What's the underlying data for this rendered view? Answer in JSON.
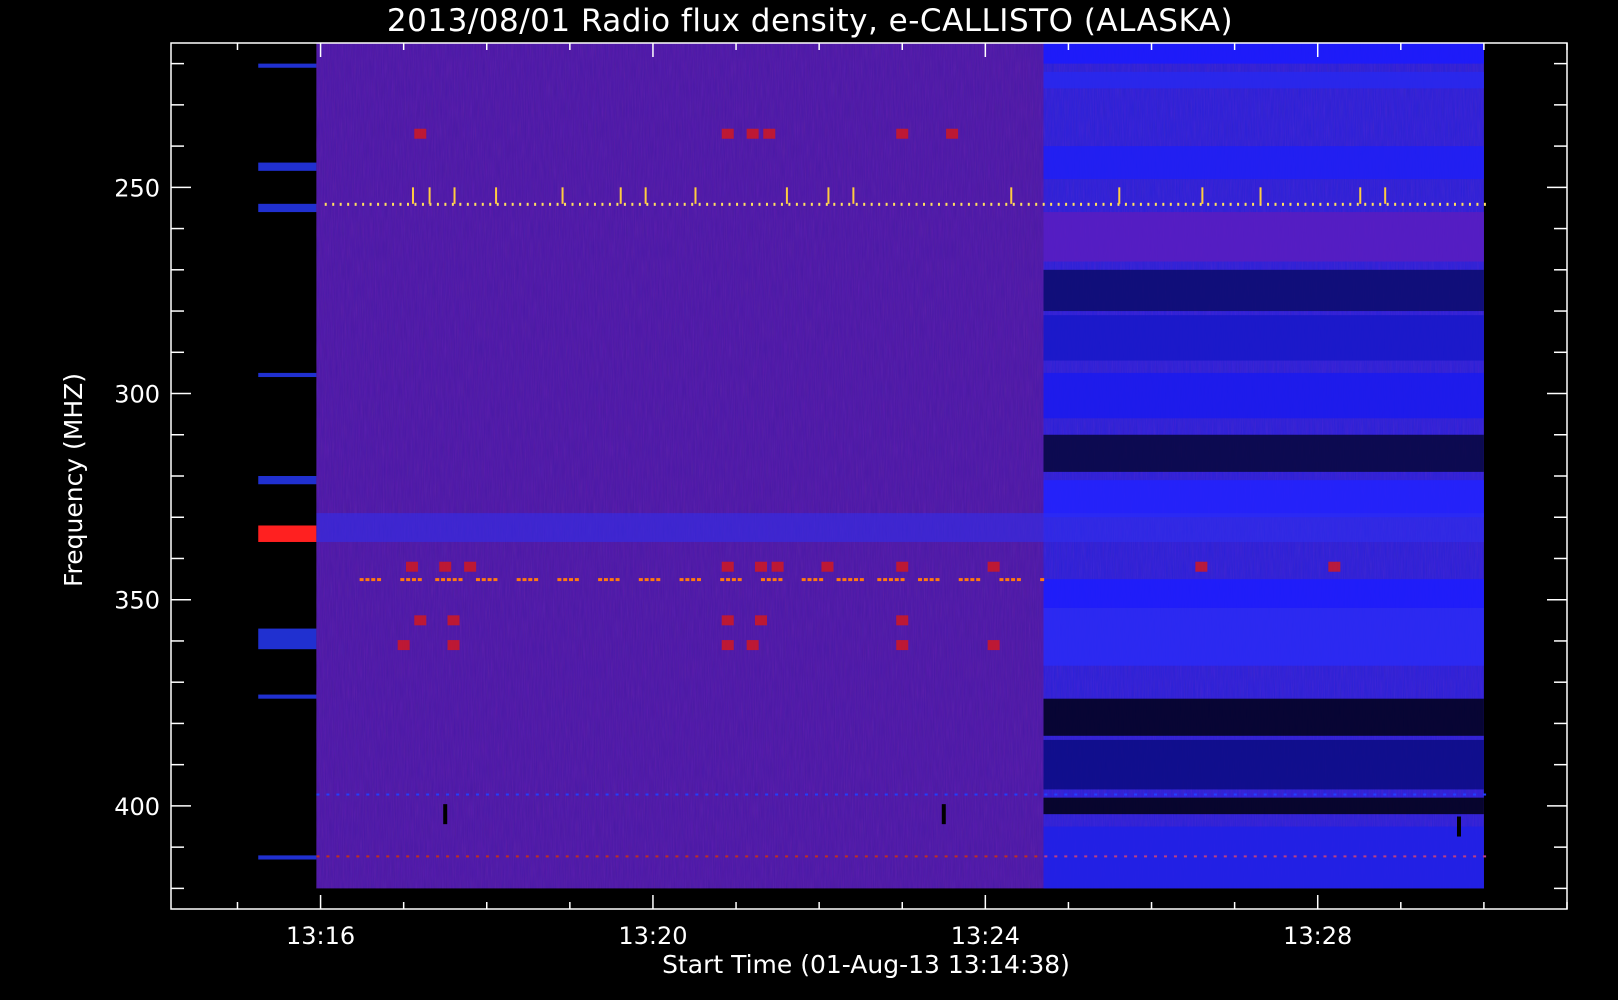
{
  "chart_data": {
    "type": "heatmap",
    "title": "2013/08/01  Radio flux density, e-CALLISTO (ALASKA)",
    "xlabel": "Start Time (01-Aug-13 13:14:38)",
    "ylabel": "Frequency (MHZ)",
    "x_ticks": [
      "13:16",
      "13:20",
      "13:24",
      "13:28"
    ],
    "x_tick_minutes": [
      16,
      20,
      24,
      28
    ],
    "xlim_minutes": [
      14.2,
      31
    ],
    "x_minor_step_minutes": 1,
    "y_ticks": [
      250,
      300,
      350,
      400
    ],
    "ylim": [
      215,
      425
    ],
    "y_minor_step": 10,
    "y_inverted": true,
    "data_start_minute": 15.25,
    "data_gap_end_minute": 15.95,
    "data_end_minute": 30,
    "data_freq_range": [
      215,
      420
    ],
    "segments": [
      {
        "start_minute": 15.95,
        "end_minute": 24.7,
        "base_color": "#4a18a6"
      },
      {
        "start_minute": 24.7,
        "end_minute": 30,
        "base_color": "#2a20d8"
      }
    ],
    "blue_bands_mhz": [
      {
        "from": 215,
        "to": 220,
        "color": "#1a1aff"
      },
      {
        "from": 222,
        "to": 226,
        "color": "#2828ee"
      },
      {
        "from": 240,
        "to": 248,
        "color": "#1e1ef6"
      },
      {
        "from": 256,
        "to": 268,
        "color": "#5a1cc0"
      },
      {
        "from": 270,
        "to": 280,
        "color": "#0a0a6a"
      },
      {
        "from": 281,
        "to": 292,
        "color": "#1818c8"
      },
      {
        "from": 295,
        "to": 306,
        "color": "#1a1aee"
      },
      {
        "from": 310,
        "to": 319,
        "color": "#06063a"
      },
      {
        "from": 321,
        "to": 330,
        "color": "#2222ff"
      },
      {
        "from": 345,
        "to": 352,
        "color": "#1c1cff"
      },
      {
        "from": 352,
        "to": 366,
        "color": "#2a2af6"
      },
      {
        "from": 374,
        "to": 383,
        "color": "#000018"
      },
      {
        "from": 384,
        "to": 396,
        "color": "#0a0a80"
      },
      {
        "from": 398,
        "to": 402,
        "color": "#000010"
      },
      {
        "from": 405,
        "to": 420,
        "color": "#2020e6"
      }
    ],
    "red_bands_mhz": [
      {
        "freq": 237,
        "minutes": [
          17.2,
          20.9,
          21.2,
          21.4,
          23.0,
          23.6
        ]
      },
      {
        "freq": 342,
        "minutes": [
          17.1,
          17.5,
          17.8,
          20.9,
          21.3,
          21.5,
          22.1,
          23.0,
          24.1,
          26.6,
          28.2
        ]
      },
      {
        "freq": 355,
        "minutes": [
          17.2,
          17.6,
          20.9,
          21.3,
          23.0
        ]
      },
      {
        "freq": 361,
        "minutes": [
          17.0,
          17.6,
          20.9,
          21.2,
          23.0,
          24.1
        ]
      }
    ],
    "spike_line_mhz": 254,
    "horizontal_line_mhz": 345,
    "horizontal_line_range_minutes": [
      16.4,
      24.7
    ],
    "dark_notches": [
      {
        "minute": 17.5,
        "freq": 402
      },
      {
        "minute": 23.5,
        "freq": 402
      },
      {
        "minute": 29.7,
        "freq": 405
      }
    ]
  }
}
